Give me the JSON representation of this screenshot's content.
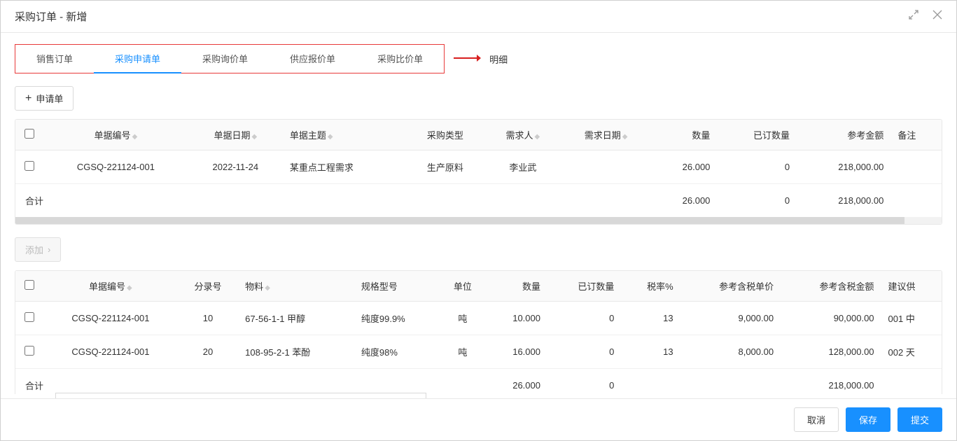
{
  "header": {
    "title": "采购订单 - 新增"
  },
  "tabs": [
    "销售订单",
    "采购申请单",
    "采购询价单",
    "供应报价单",
    "采购比价单"
  ],
  "activeTab": 1,
  "detailLabel": "明细",
  "addButton": "申请单",
  "addButton2": "添加",
  "table1": {
    "columns": [
      "单据编号",
      "单据日期",
      "单据主题",
      "采购类型",
      "需求人",
      "需求日期",
      "数量",
      "已订数量",
      "参考金额",
      "备注"
    ],
    "rows": [
      {
        "docNo": "CGSQ-221124-001",
        "date": "2022-11-24",
        "subject": "某重点工程需求",
        "type": "生产原料",
        "person": "李业武",
        "reqDate": "",
        "qty": "26.000",
        "orderedQty": "0",
        "refAmount": "218,000.00",
        "remark": ""
      }
    ],
    "total": {
      "label": "合计",
      "qty": "26.000",
      "orderedQty": "0",
      "refAmount": "218,000.00"
    }
  },
  "table2": {
    "columns": [
      "单据编号",
      "分录号",
      "物料",
      "规格型号",
      "单位",
      "数量",
      "已订数量",
      "税率%",
      "参考含税单价",
      "参考含税金额",
      "建议供"
    ],
    "rows": [
      {
        "docNo": "CGSQ-221124-001",
        "entry": "10",
        "material": "67-56-1-1 甲醇",
        "spec": "纯度99.9%",
        "unit": "吨",
        "qty": "10.000",
        "orderedQty": "0",
        "taxRate": "13",
        "unitPrice": "9,000.00",
        "amount": "90,000.00",
        "supplier": "001 中"
      },
      {
        "docNo": "CGSQ-221124-001",
        "entry": "20",
        "material": "108-95-2-1 苯酚",
        "spec": "纯度98%",
        "unit": "吨",
        "qty": "16.000",
        "orderedQty": "0",
        "taxRate": "13",
        "unitPrice": "8,000.00",
        "amount": "128,000.00",
        "supplier": "002 天"
      }
    ],
    "total": {
      "label": "合计",
      "qty": "26.000",
      "orderedQty": "0",
      "amount": "218,000.00"
    }
  },
  "footer": {
    "cancel": "取消",
    "save": "保存",
    "submit": "提交"
  }
}
